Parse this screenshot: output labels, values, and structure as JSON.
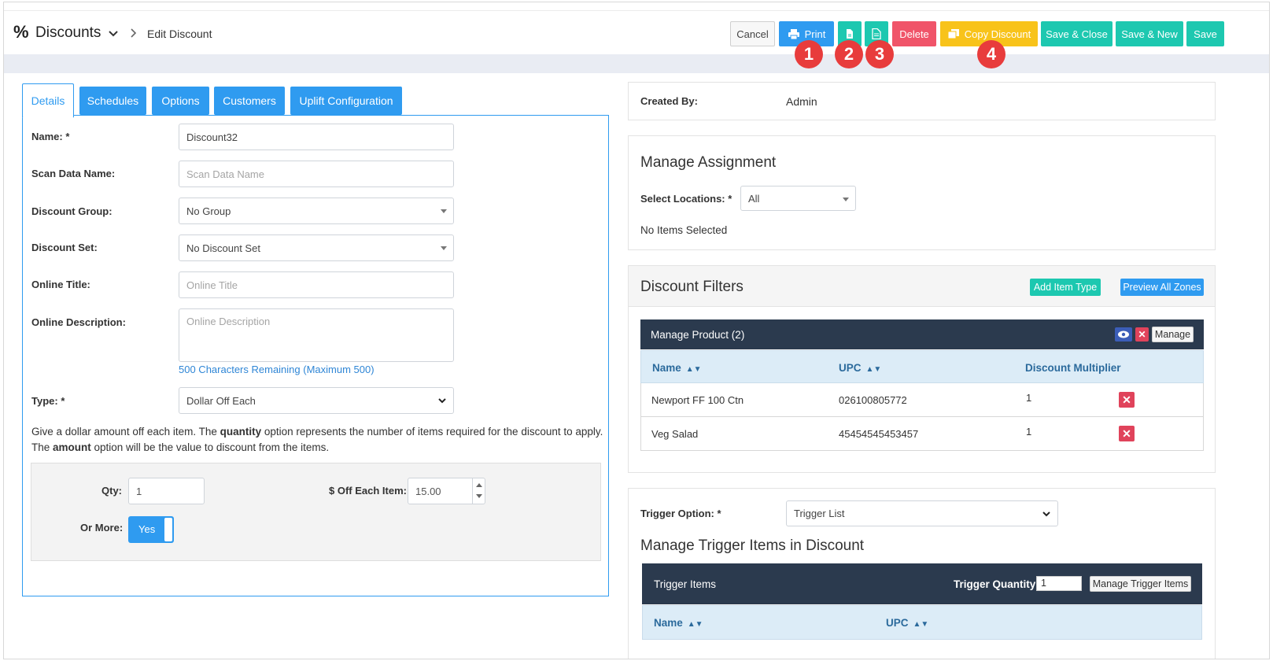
{
  "header": {
    "app_icon": "%",
    "app_title": "Discounts",
    "breadcrumb": "Edit Discount"
  },
  "toolbar": {
    "cancel": "Cancel",
    "print": "Print",
    "delete": "Delete",
    "copy": "Copy Discount",
    "save_close": "Save & Close",
    "save_new": "Save & New",
    "save": "Save"
  },
  "markers": [
    "1",
    "2",
    "3",
    "4"
  ],
  "tabs": [
    "Details",
    "Schedules",
    "Options",
    "Customers",
    "Uplift Configuration"
  ],
  "form": {
    "name_label": "Name: *",
    "name_value": "Discount32",
    "scan_label": "Scan Data Name:",
    "scan_placeholder": "Scan Data Name",
    "group_label": "Discount Group:",
    "group_value": "No Group",
    "set_label": "Discount Set:",
    "set_value": "No Discount Set",
    "online_title_label": "Online Title:",
    "online_title_placeholder": "Online Title",
    "online_desc_label": "Online Description:",
    "online_desc_placeholder": "Online Description",
    "chars_remaining": "500 Characters Remaining (Maximum 500)",
    "type_label": "Type: *",
    "type_value": "Dollar Off Each",
    "desc_1a": "Give a dollar amount off each item. The ",
    "desc_1b": "quantity",
    "desc_1c": " option represents the number of items required for the discount to apply.",
    "desc_2a": "The ",
    "desc_2b": "amount",
    "desc_2c": " option will be the value to discount from the items.",
    "qty_label": "Qty:",
    "qty_value": "1",
    "off_label": "$ Off Each Item:",
    "off_value": "15.00",
    "or_more_label": "Or More:",
    "or_more_value": "Yes"
  },
  "created": {
    "label": "Created By:",
    "value": "Admin"
  },
  "assignment": {
    "title": "Manage Assignment",
    "locations_label": "Select Locations: *",
    "locations_value": "All",
    "none_selected": "No Items Selected"
  },
  "filters": {
    "title": "Discount Filters",
    "add_item_type": "Add Item Type",
    "preview_zones": "Preview All Zones",
    "product_title": "Manage Product (2)",
    "manage": "Manage",
    "columns": [
      "Name",
      "UPC",
      "Discount Multiplier"
    ],
    "rows": [
      {
        "name": "Newport FF 100 Ctn",
        "upc": "026100805772",
        "multiplier": "1"
      },
      {
        "name": "Veg Salad",
        "upc": "45454545453457",
        "multiplier": "1"
      }
    ]
  },
  "trigger": {
    "option_label": "Trigger Option: *",
    "option_value": "Trigger List",
    "title": "Manage Trigger Items in Discount",
    "items_title": "Trigger Items",
    "qty_label": "Trigger Quantity",
    "qty_value": "1",
    "manage_btn": "Manage Trigger Items",
    "columns": [
      "Name",
      "UPC"
    ]
  },
  "colors": {
    "blue": "#2f9bf0",
    "teal": "#1dc8b0",
    "red": "#f05469",
    "yellow": "#f8c31a",
    "dark": "#2b3a4e",
    "marker": "#e83c3c"
  },
  "icons": [
    "percent-icon",
    "chevron-down-icon",
    "chevron-right-icon",
    "printer-icon",
    "document-icon",
    "copy-icon",
    "eye-icon",
    "close-icon",
    "sort-icon"
  ]
}
